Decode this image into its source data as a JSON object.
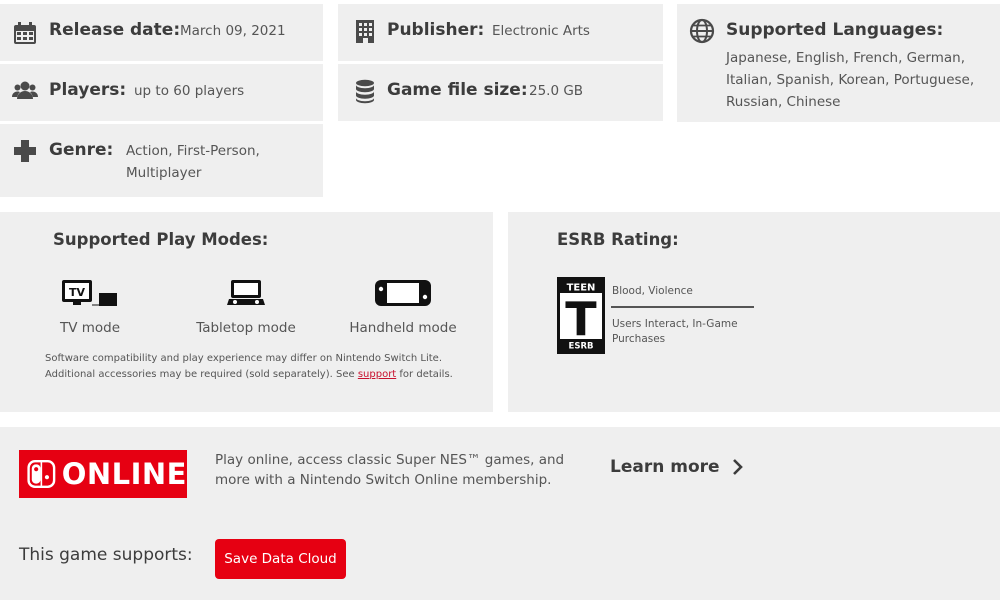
{
  "release": {
    "label": "Release date:",
    "value": "March 09, 2021",
    "icon": "calendar-icon"
  },
  "publisher": {
    "label": "Publisher:",
    "value": "Electronic Arts",
    "icon": "building-icon"
  },
  "languages": {
    "label": "Supported Languages:",
    "value": "Japanese, English, French, German, Italian, Spanish, Korean, Portuguese, Russian, Chinese",
    "icon": "globe-icon"
  },
  "players": {
    "label": "Players:",
    "value": "up to 60 players",
    "icon": "users-icon"
  },
  "filesize": {
    "label": "Game file size:",
    "value": "25.0 GB",
    "icon": "database-icon"
  },
  "genre": {
    "label": "Genre:",
    "value": "Action, First-Person, Multiplayer",
    "icon": "dpad-icon"
  },
  "play_modes": {
    "title": "Supported Play Modes:",
    "modes": [
      {
        "label": "TV mode",
        "icon": "tv-mode-icon",
        "tv_text": "TV"
      },
      {
        "label": "Tabletop mode",
        "icon": "tabletop-mode-icon"
      },
      {
        "label": "Handheld mode",
        "icon": "handheld-mode-icon"
      }
    ],
    "note_before": "Software compatibility and play experience may differ on Nintendo Switch Lite. Additional accessories may be required (sold separately). See ",
    "note_link": "support",
    "note_after": " for details."
  },
  "esrb": {
    "title": "ESRB Rating:",
    "rating_top": "TEEN",
    "rating_letter": "T",
    "rating_bottom": "ESRB",
    "content_descriptors": "Blood, Violence",
    "interactive_elements": "Users Interact, In-Game Purchases"
  },
  "online": {
    "logo_text": "ONLINE",
    "description": "Play online, access classic Super NES™ games, and more with a Nintendo Switch Online membership.",
    "learn_more": "Learn more",
    "supports_label": "This game supports:",
    "save_button": "Save Data Cloud"
  },
  "colors": {
    "brand_red": "#e60012",
    "card_bg": "#efefef",
    "text": "#3c3c3c"
  }
}
